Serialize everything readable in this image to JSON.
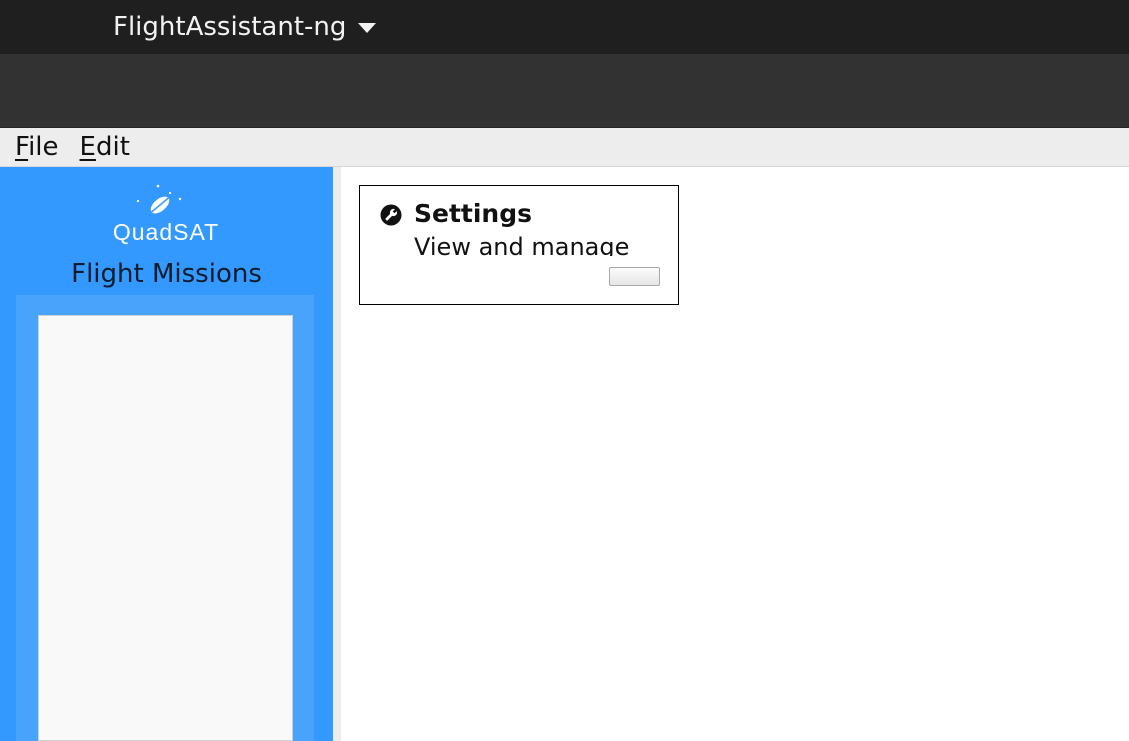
{
  "topbar": {
    "app_name": "FlightAssistant-ng",
    "menu_icon": "chevron-down-icon"
  },
  "menubar": {
    "items": [
      {
        "mnemonic": "F",
        "rest": "ile"
      },
      {
        "mnemonic": "E",
        "rest": "dit"
      }
    ]
  },
  "sidebar": {
    "logo_text": "QuadSAT",
    "title": "Flight Missions",
    "background": "#3399ff"
  },
  "content": {
    "cards": [
      {
        "icon": "wrench-icon",
        "title": "Settings",
        "description": "View and manage",
        "button_label": "..."
      }
    ]
  }
}
